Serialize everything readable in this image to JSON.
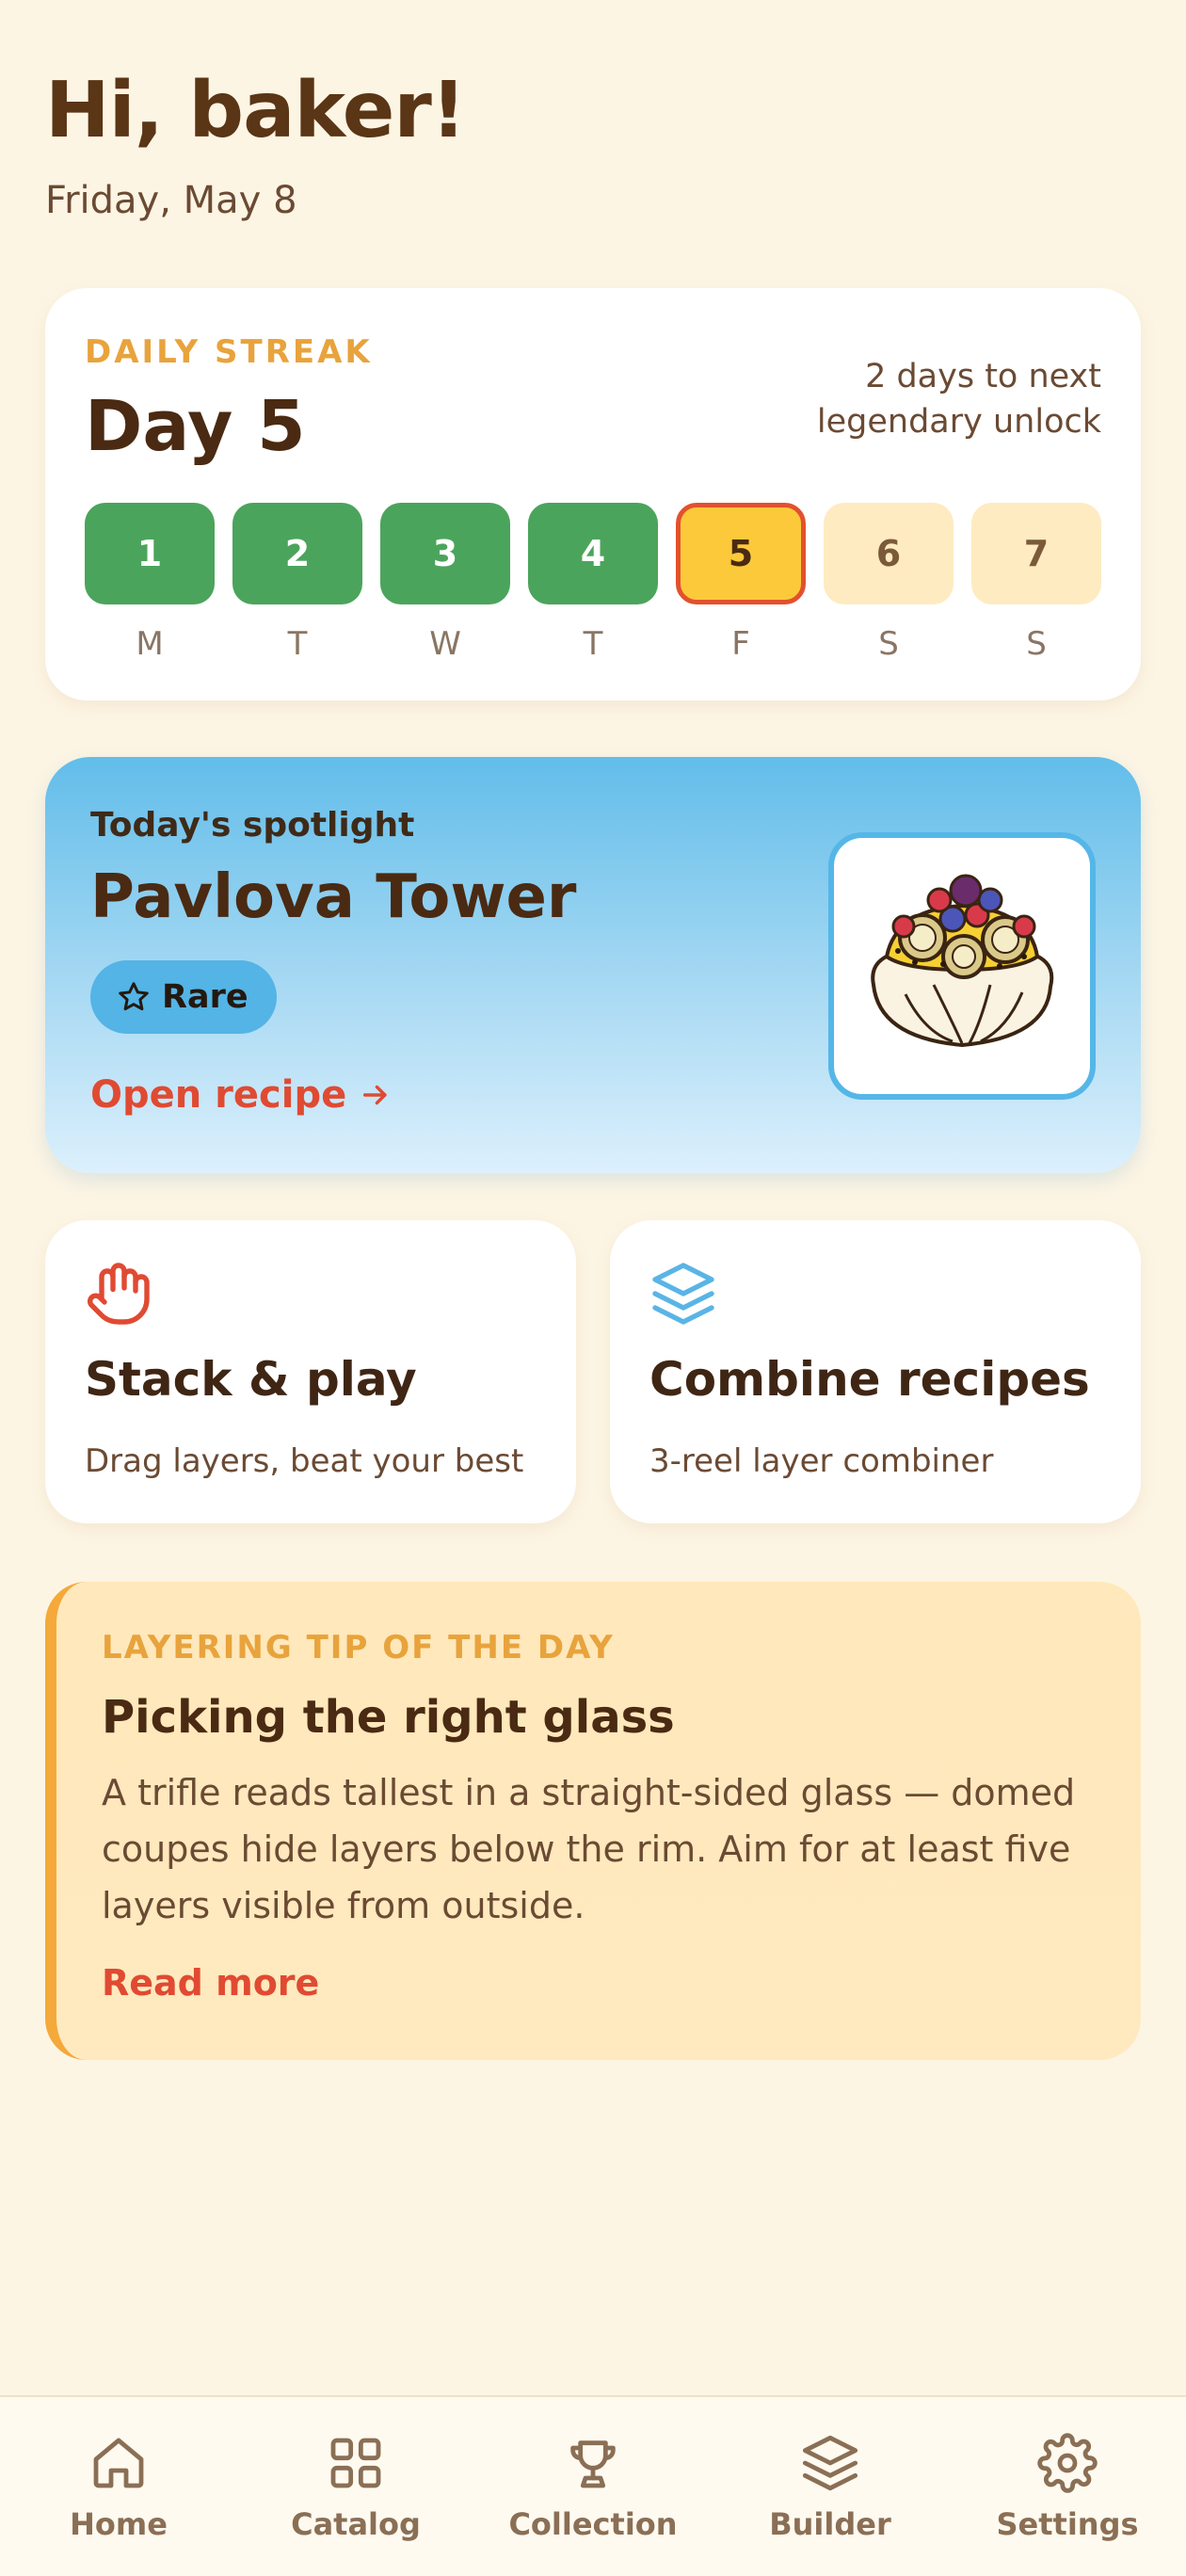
{
  "header": {
    "greeting": "Hi, baker!",
    "date": "Friday, May 8"
  },
  "streak": {
    "eyebrow": "DAILY STREAK",
    "day_label": "Day 5",
    "next_unlock": "2 days to next legendary unlock",
    "days": [
      {
        "num": "1",
        "letter": "M",
        "state": "done"
      },
      {
        "num": "2",
        "letter": "T",
        "state": "done"
      },
      {
        "num": "3",
        "letter": "W",
        "state": "done"
      },
      {
        "num": "4",
        "letter": "T",
        "state": "done"
      },
      {
        "num": "5",
        "letter": "F",
        "state": "today"
      },
      {
        "num": "6",
        "letter": "S",
        "state": "future"
      },
      {
        "num": "7",
        "letter": "S",
        "state": "future"
      }
    ]
  },
  "spotlight": {
    "eyebrow": "Today's spotlight",
    "title": "Pavlova Tower",
    "rarity": "Rare",
    "cta": "Open recipe",
    "image_icon": "pavlova-illustration"
  },
  "actions": [
    {
      "title": "Stack & play",
      "subtitle": "Drag layers, beat your best",
      "icon": "hand-icon"
    },
    {
      "title": "Combine recipes",
      "subtitle": "3-reel layer combiner",
      "icon": "layers-icon"
    }
  ],
  "tip": {
    "eyebrow": "LAYERING TIP OF THE DAY",
    "title": "Picking the right glass",
    "body": "A trifle reads tallest in a straight-sided glass — domed coupes hide layers below the rim. Aim for at least five layers visible from outside.",
    "cta": "Read more"
  },
  "tabs": [
    {
      "label": "Home",
      "icon": "home-icon"
    },
    {
      "label": "Catalog",
      "icon": "grid-icon"
    },
    {
      "label": "Collection",
      "icon": "trophy-icon"
    },
    {
      "label": "Builder",
      "icon": "layers-icon"
    },
    {
      "label": "Settings",
      "icon": "gear-icon"
    }
  ],
  "colors": {
    "background": "#fdf5e4",
    "done": "#4ba45c",
    "today": "#fcc93a",
    "future": "#feebc1",
    "accent_red": "#e04a32",
    "accent_orange": "#e8a33c",
    "sky": "#62bdea"
  }
}
